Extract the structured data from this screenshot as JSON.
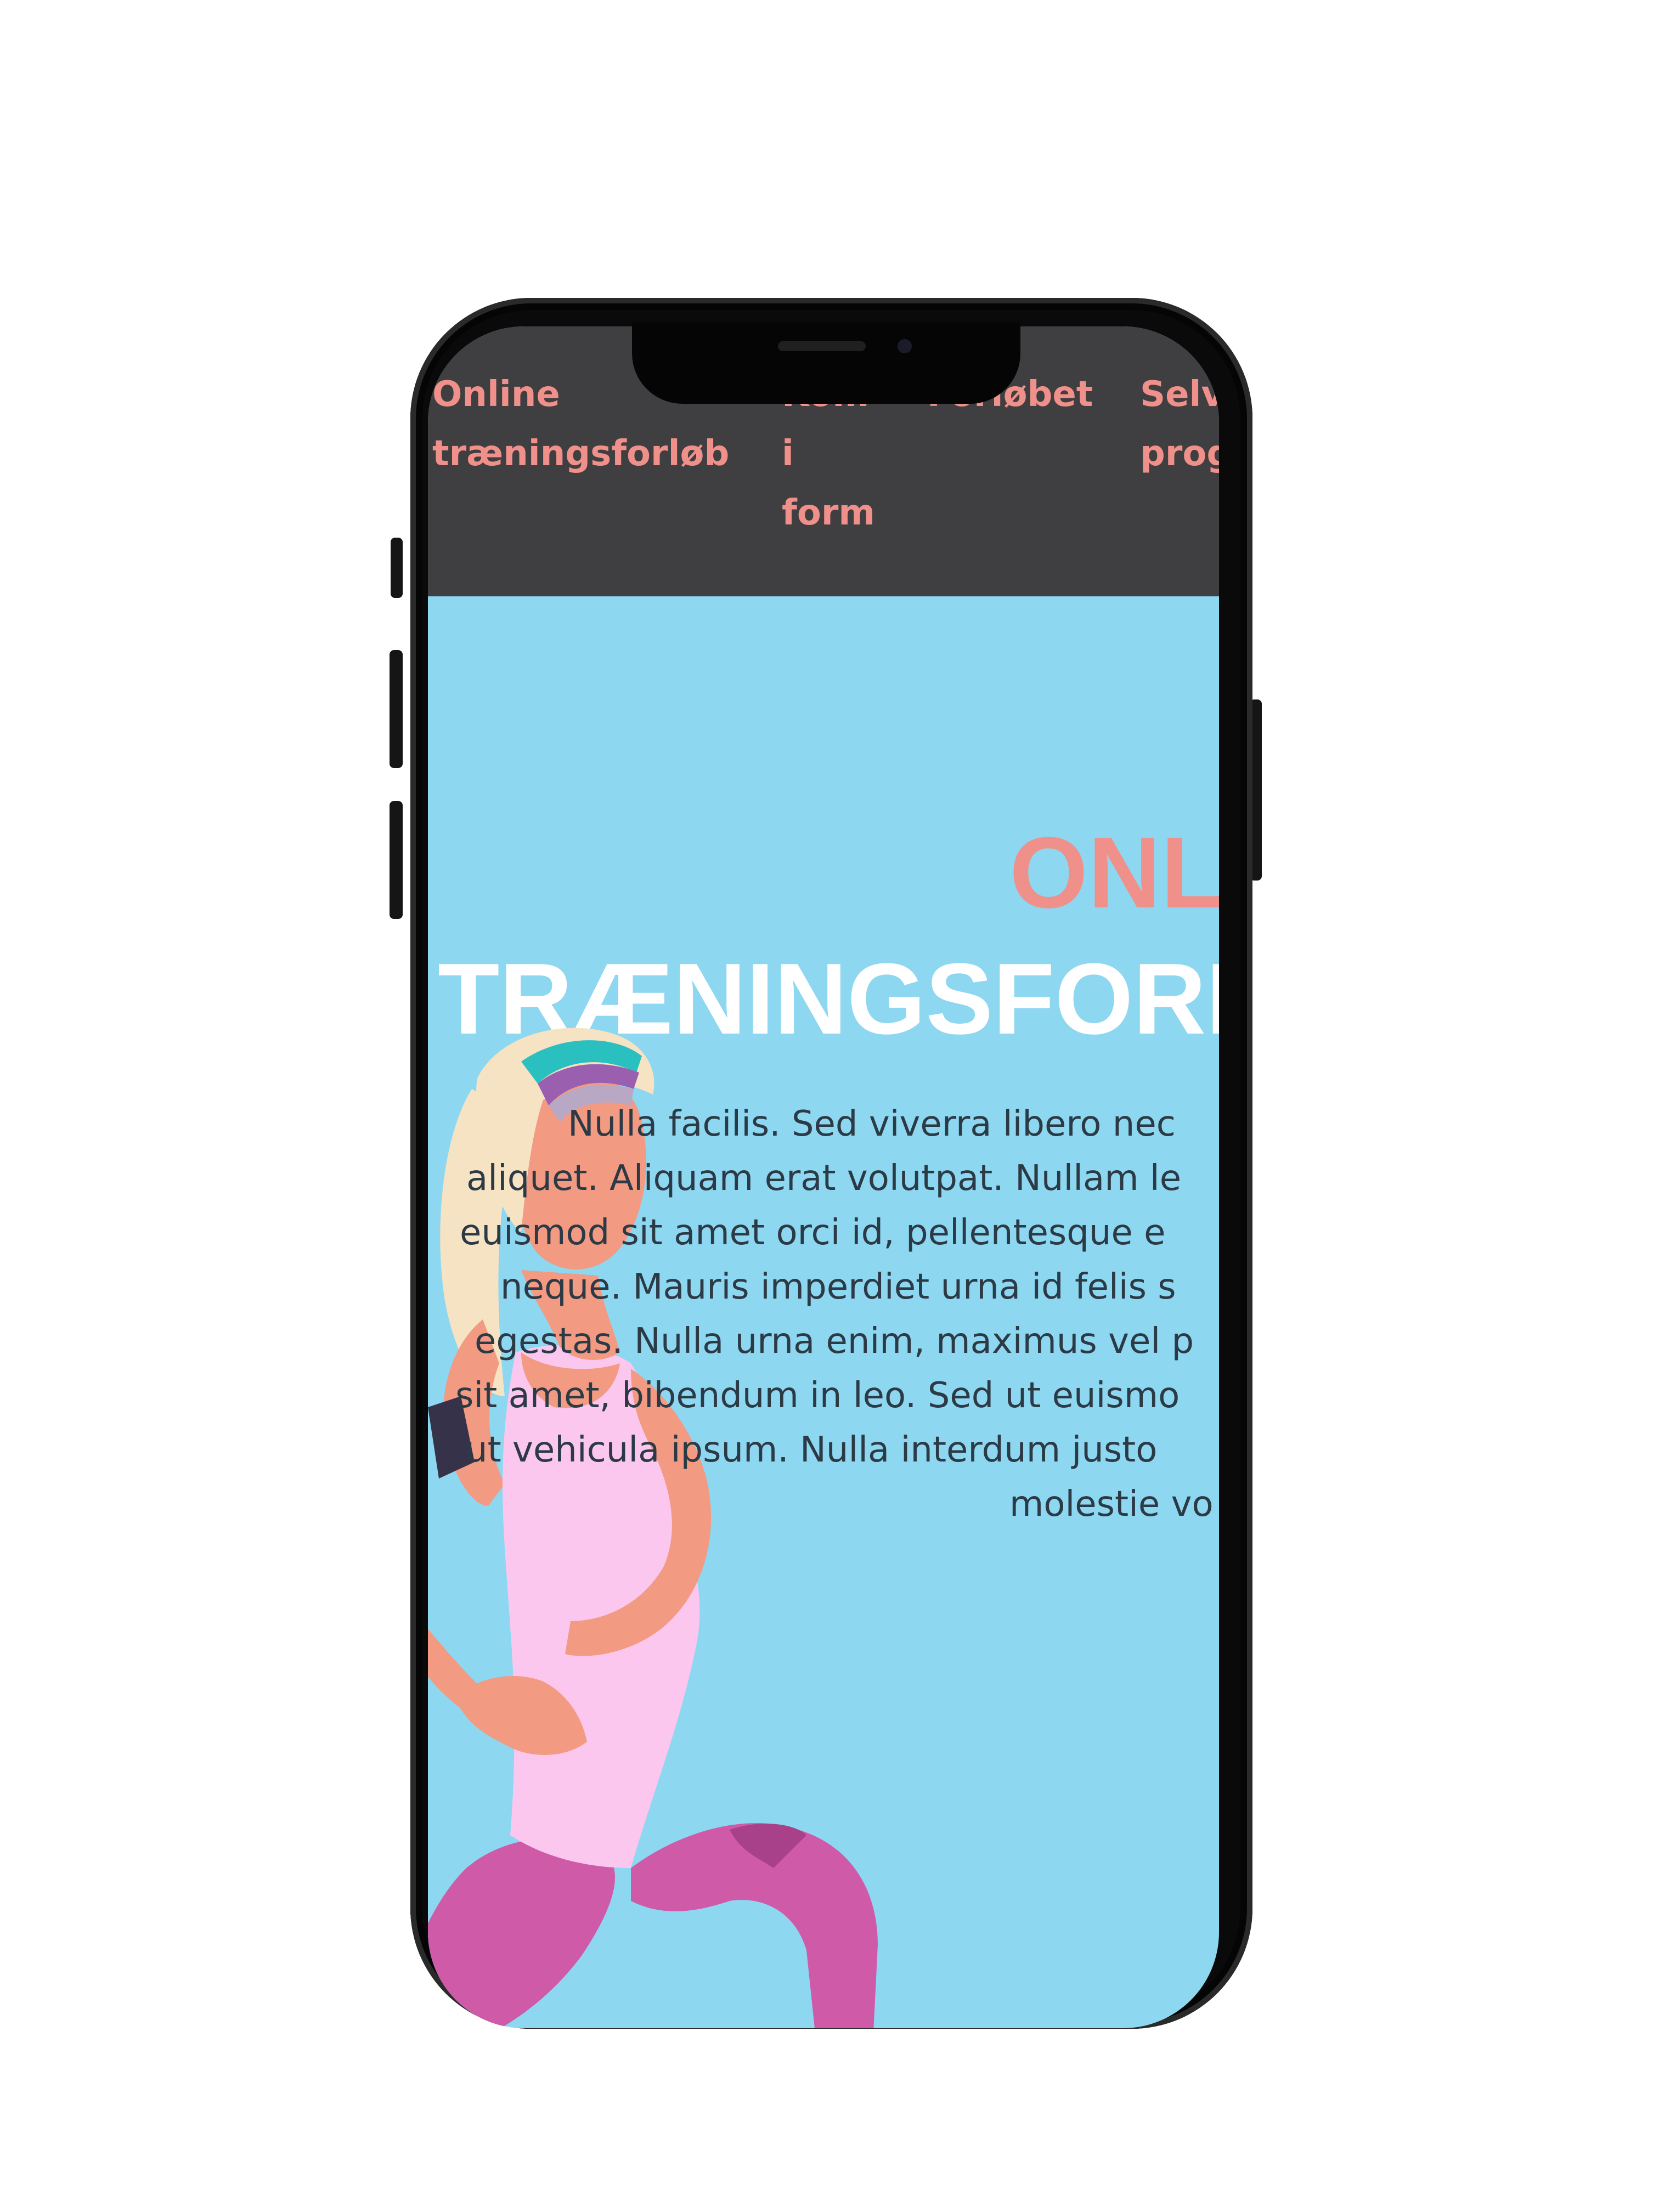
{
  "nav": {
    "items": [
      {
        "words": [
          "Online",
          "træningsforløb"
        ]
      },
      {
        "words": [
          "Kom",
          "i",
          "form"
        ]
      },
      {
        "words": [
          "Forløbet"
        ]
      },
      {
        "words": [
          "Selv",
          "prog"
        ]
      }
    ]
  },
  "hero": {
    "title_top": "ONL",
    "title_bottom": "TRÆNINGSFORL",
    "body_lines": [
      "Nulla facilis. Sed viverra libero nec",
      "aliquet. Aliquam erat volutpat. Nullam le",
      "euismod sit amet orci id, pellentesque e",
      "neque. Mauris imperdiet urna id felis s",
      "egestas. Nulla urna enim, maximus vel p",
      "sit amet, bibendum in leo. Sed ut euismo",
      "ut vehicula ipsum. Nulla interdum justo",
      "molestie vo"
    ]
  },
  "colors": {
    "nav_bg": "#3f3e40",
    "nav_text": "#f0908a",
    "hero_bg": "#8dd7f1",
    "title_accent": "#f0908a",
    "title_white": "#ffffff",
    "body_text": "#2c3a46"
  },
  "illustration": {
    "icon": "woman-exercising-illustration"
  }
}
